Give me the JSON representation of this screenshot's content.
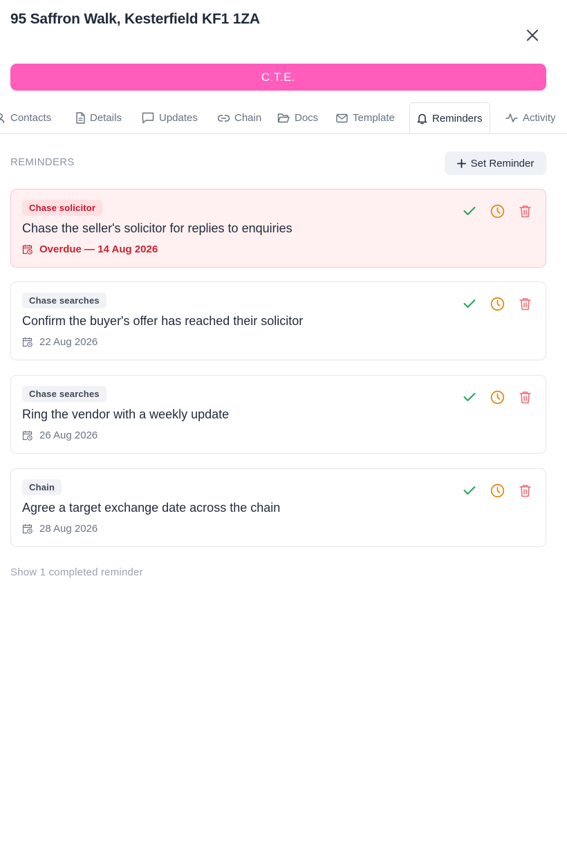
{
  "header": {
    "title": "95 Saffron Walk, Kesterfield KF1 1ZA",
    "status_button": "C.T.E.",
    "status_color": "#ff5cbc"
  },
  "tabs": [
    {
      "label": "Contacts",
      "icon": "user-icon"
    },
    {
      "label": "Details",
      "icon": "document-icon"
    },
    {
      "label": "Updates",
      "icon": "message-icon"
    },
    {
      "label": "Chain",
      "icon": "link-icon"
    },
    {
      "label": "Docs",
      "icon": "folder-icon"
    },
    {
      "label": "Template",
      "icon": "mail-icon"
    },
    {
      "label": "Reminders",
      "icon": "bell-icon",
      "active": true
    },
    {
      "label": "Activity",
      "icon": "activity-icon"
    }
  ],
  "reminders_section": {
    "label": "REMINDERS",
    "set_button": "Set Reminder",
    "show_completed": "Show 1 completed reminder",
    "items": [
      {
        "category": "Chase solicitor",
        "text": "Chase the seller's solicitor for replies to enquiries",
        "date": "Overdue — 14 Aug 2026",
        "overdue": true
      },
      {
        "category": "Chase searches",
        "text": "Confirm the buyer's offer has reached their solicitor",
        "date": "22 Aug 2026",
        "overdue": false
      },
      {
        "category": "Chase searches",
        "text": "Ring the vendor with a weekly update",
        "date": "26 Aug 2026",
        "overdue": false
      },
      {
        "category": "Chain",
        "text": "Agree a target exchange date across the chain",
        "date": "28 Aug 2026",
        "overdue": false
      }
    ]
  },
  "colors": {
    "complete": "#22a35a",
    "snooze": "#e08a12",
    "delete": "#ef6b73",
    "overdue_text": "#d01f2f"
  }
}
